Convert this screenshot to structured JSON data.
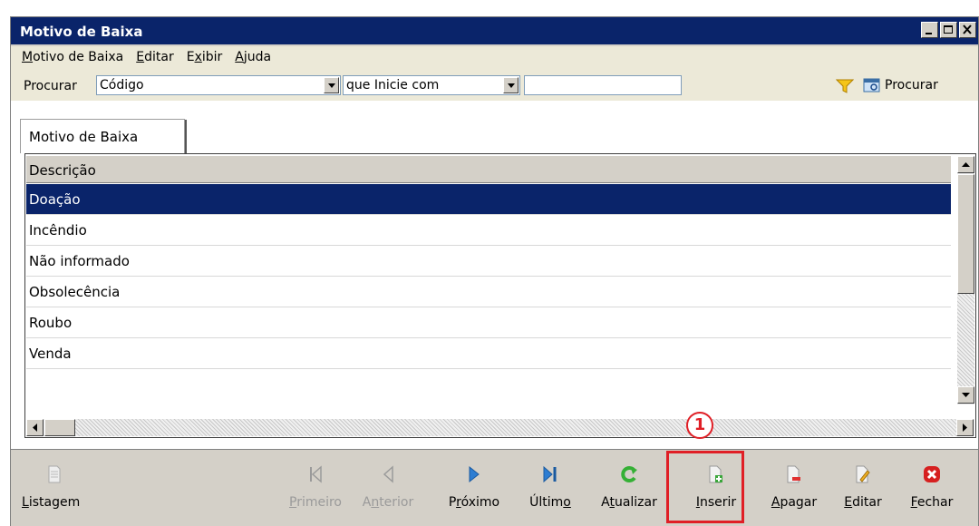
{
  "window": {
    "title": "Motivo de Baixa"
  },
  "menu": {
    "items": [
      {
        "label": "Motivo de Baixa"
      },
      {
        "label": "Editar"
      },
      {
        "label": "Exibir"
      },
      {
        "label": "Ajuda"
      }
    ]
  },
  "search": {
    "label": "Procurar",
    "field_value": "Código",
    "mode_value": "que Inicie com",
    "text_value": "",
    "button_label": "Procurar"
  },
  "tab": {
    "label": "Motivo de Baixa"
  },
  "grid": {
    "column": "Descrição",
    "rows": [
      "Doação",
      "Incêndio",
      "Não informado",
      "Obsolecência",
      "Roubo",
      "Venda"
    ],
    "selected_index": 0
  },
  "toolbar": {
    "listagem": "Listagem",
    "primeiro": "Primeiro",
    "anterior": "Anterior",
    "proximo": "Próximo",
    "ultimo": "Último",
    "atualizar": "Atualizar",
    "inserir": "Inserir",
    "apagar": "Apagar",
    "editar": "Editar",
    "fechar": "Fechar"
  },
  "annotation": {
    "marker": "1"
  },
  "colors": {
    "titlebar": "#0a246a",
    "selection": "#0a246a",
    "highlight": "#e01f26"
  }
}
